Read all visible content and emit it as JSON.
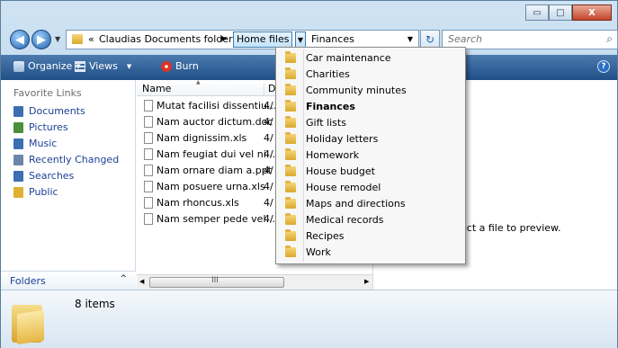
{
  "caption": {
    "min": "▭",
    "max": "□",
    "close": "X"
  },
  "address": {
    "prefix": "«",
    "crumb1": "Claudias Documents folders",
    "sep1": "▶",
    "crumb2": "Home files",
    "drop": "▼",
    "crumb3": "Finances",
    "dropdown_arrow": "▼"
  },
  "search": {
    "placeholder": "Search"
  },
  "toolbar": {
    "organize": "Organize",
    "views": "Views",
    "burn": "Burn",
    "arrow": "▼",
    "help": "?"
  },
  "nav": {
    "heading": "Favorite Links",
    "items": [
      {
        "label": "Documents",
        "icon": "documents-icon",
        "color": "#3b6fb4"
      },
      {
        "label": "Pictures",
        "icon": "pictures-icon",
        "color": "#4a8f3c"
      },
      {
        "label": "Music",
        "icon": "music-icon",
        "color": "#3b6fb4"
      },
      {
        "label": "Recently Changed",
        "icon": "recent-icon",
        "color": "#6b86a8"
      },
      {
        "label": "Searches",
        "icon": "searches-icon",
        "color": "#3b6fb4"
      },
      {
        "label": "Public",
        "icon": "public-folder-icon",
        "color": "#e0b030"
      }
    ],
    "folders_label": "Folders",
    "folders_chevron": "^"
  },
  "list": {
    "columns": {
      "name": "Name",
      "date": "Da"
    },
    "files": [
      {
        "name": "Mutat facilisi dissentiu...",
        "date": "4/"
      },
      {
        "name": "Nam auctor dictum.doc",
        "date": "4/"
      },
      {
        "name": "Nam dignissim.xls",
        "date": "4/"
      },
      {
        "name": "Nam feugiat dui vel ni...",
        "date": "4/"
      },
      {
        "name": "Nam ornare diam a.ppt",
        "date": "4/"
      },
      {
        "name": "Nam posuere urna.xls",
        "date": "4/"
      },
      {
        "name": "Nam rhoncus.xls",
        "date": "4/"
      },
      {
        "name": "Nam semper pede vel....",
        "date": "4/"
      }
    ],
    "scroll_left": "◀",
    "scroll_right": "▶",
    "scroll_grip": "III"
  },
  "preview": {
    "text": "ect a file to preview."
  },
  "details": {
    "count": "8 items"
  },
  "menu": {
    "items": [
      {
        "label": "Car maintenance",
        "current": false
      },
      {
        "label": "Charities",
        "current": false
      },
      {
        "label": "Community minutes",
        "current": false
      },
      {
        "label": "Finances",
        "current": true
      },
      {
        "label": "Gift lists",
        "current": false
      },
      {
        "label": "Holiday letters",
        "current": false
      },
      {
        "label": "Homework",
        "current": false
      },
      {
        "label": "House budget",
        "current": false
      },
      {
        "label": "House remodel",
        "current": false
      },
      {
        "label": "Maps and directions",
        "current": false
      },
      {
        "label": "Medical records",
        "current": false
      },
      {
        "label": "Recipes",
        "current": false
      },
      {
        "label": "Work",
        "current": false
      }
    ]
  }
}
